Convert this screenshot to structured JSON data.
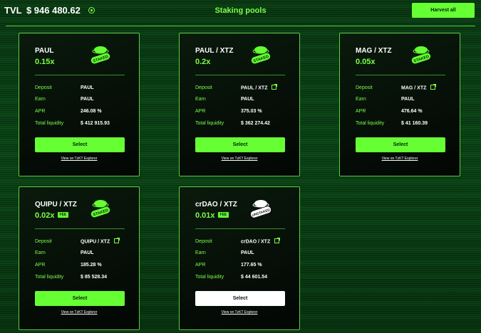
{
  "header": {
    "tvl_label": "TVL",
    "tvl_value": "$ 946 480.62",
    "page_title": "Staking pools",
    "harvest_label": "Harvest all"
  },
  "labels": {
    "deposit": "Deposit",
    "earn": "Earn",
    "apr": "APR",
    "liquidity": "Total liquidity",
    "select": "Select",
    "explorer": "View on TzKT Explorer",
    "fee": "FEE"
  },
  "colors": {
    "accent": "#66ff33",
    "staked_badge": "#66ff33",
    "unstaked_badge": "#ffffff"
  },
  "pools": [
    {
      "pair": "PAUL",
      "multiplier": "0.15x",
      "deposit": "PAUL",
      "earn": "PAUL",
      "apr": "246.08 %",
      "liquidity": "$ 412 915.93",
      "status": "STAKED"
    },
    {
      "pair": "PAUL / XTZ",
      "multiplier": "0.2x",
      "deposit": "PAUL / XTZ",
      "earn": "PAUL",
      "apr": "375.03 %",
      "liquidity": "$ 362 274.42",
      "status": "STAKED"
    },
    {
      "pair": "MAG / XTZ",
      "multiplier": "0.05x",
      "deposit": "MAG / XTZ",
      "earn": "PAUL",
      "apr": "476.64 %",
      "liquidity": "$ 41 160.39",
      "status": "STAKED"
    },
    {
      "pair": "QUIPU / XTZ",
      "multiplier": "0.02x",
      "deposit": "QUIPU / XTZ",
      "earn": "PAUL",
      "apr": "185.28 %",
      "liquidity": "$ 85 528.34",
      "status": "STAKED"
    },
    {
      "pair": "crDAO / XTZ",
      "multiplier": "0.01x",
      "deposit": "crDAO / XTZ",
      "earn": "PAUL",
      "apr": "177.65 %",
      "liquidity": "$ 44 601.54",
      "status": "UNSTAKED"
    }
  ]
}
